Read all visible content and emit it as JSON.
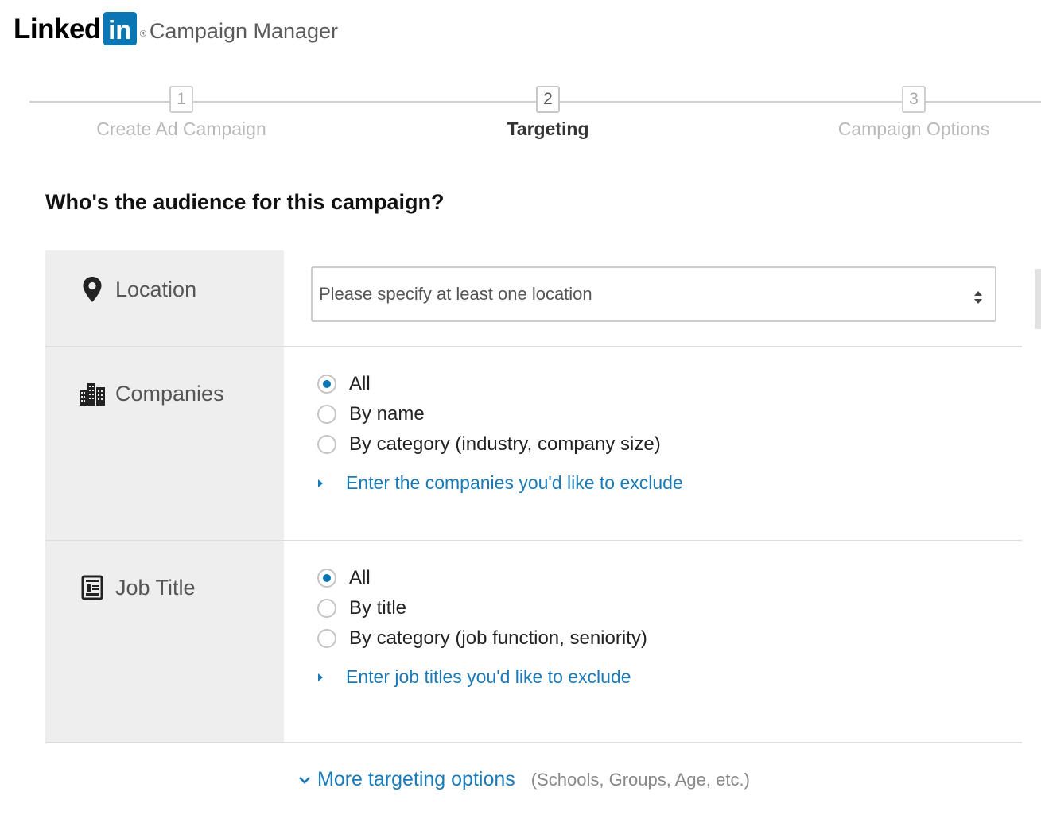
{
  "header": {
    "logo_word": "Linked",
    "logo_in": "in",
    "logo_reg": "®",
    "app_name": "Campaign Manager"
  },
  "stepper": {
    "steps": [
      {
        "number": "1",
        "label": "Create Ad Campaign",
        "state": "inactive"
      },
      {
        "number": "2",
        "label": "Targeting",
        "state": "active"
      },
      {
        "number": "3",
        "label": "Campaign Options",
        "state": "inactive"
      }
    ]
  },
  "main": {
    "question": "Who's the audience for this campaign?",
    "location": {
      "label": "Location",
      "icon": "map-pin-icon",
      "placeholder": "Please specify at least one location"
    },
    "companies": {
      "label": "Companies",
      "icon": "buildings-icon",
      "options": [
        "All",
        "By name",
        "By category (industry, company size)"
      ],
      "selected": "All",
      "exclude_link": "Enter the companies you'd like to exclude"
    },
    "job_title": {
      "label": "Job Title",
      "icon": "id-card-icon",
      "options": [
        "All",
        "By title",
        "By category (job function, seniority)"
      ],
      "selected": "All",
      "exclude_link": "Enter job titles you'd like to exclude"
    },
    "more_targeting": {
      "label": "More targeting options",
      "hint": "(Schools, Groups, Age, etc.)"
    }
  },
  "colors": {
    "brand_blue": "#0a77b4",
    "link_blue": "#1a7ab8",
    "row_bg": "#eeeeee",
    "divider": "#dddddd"
  }
}
